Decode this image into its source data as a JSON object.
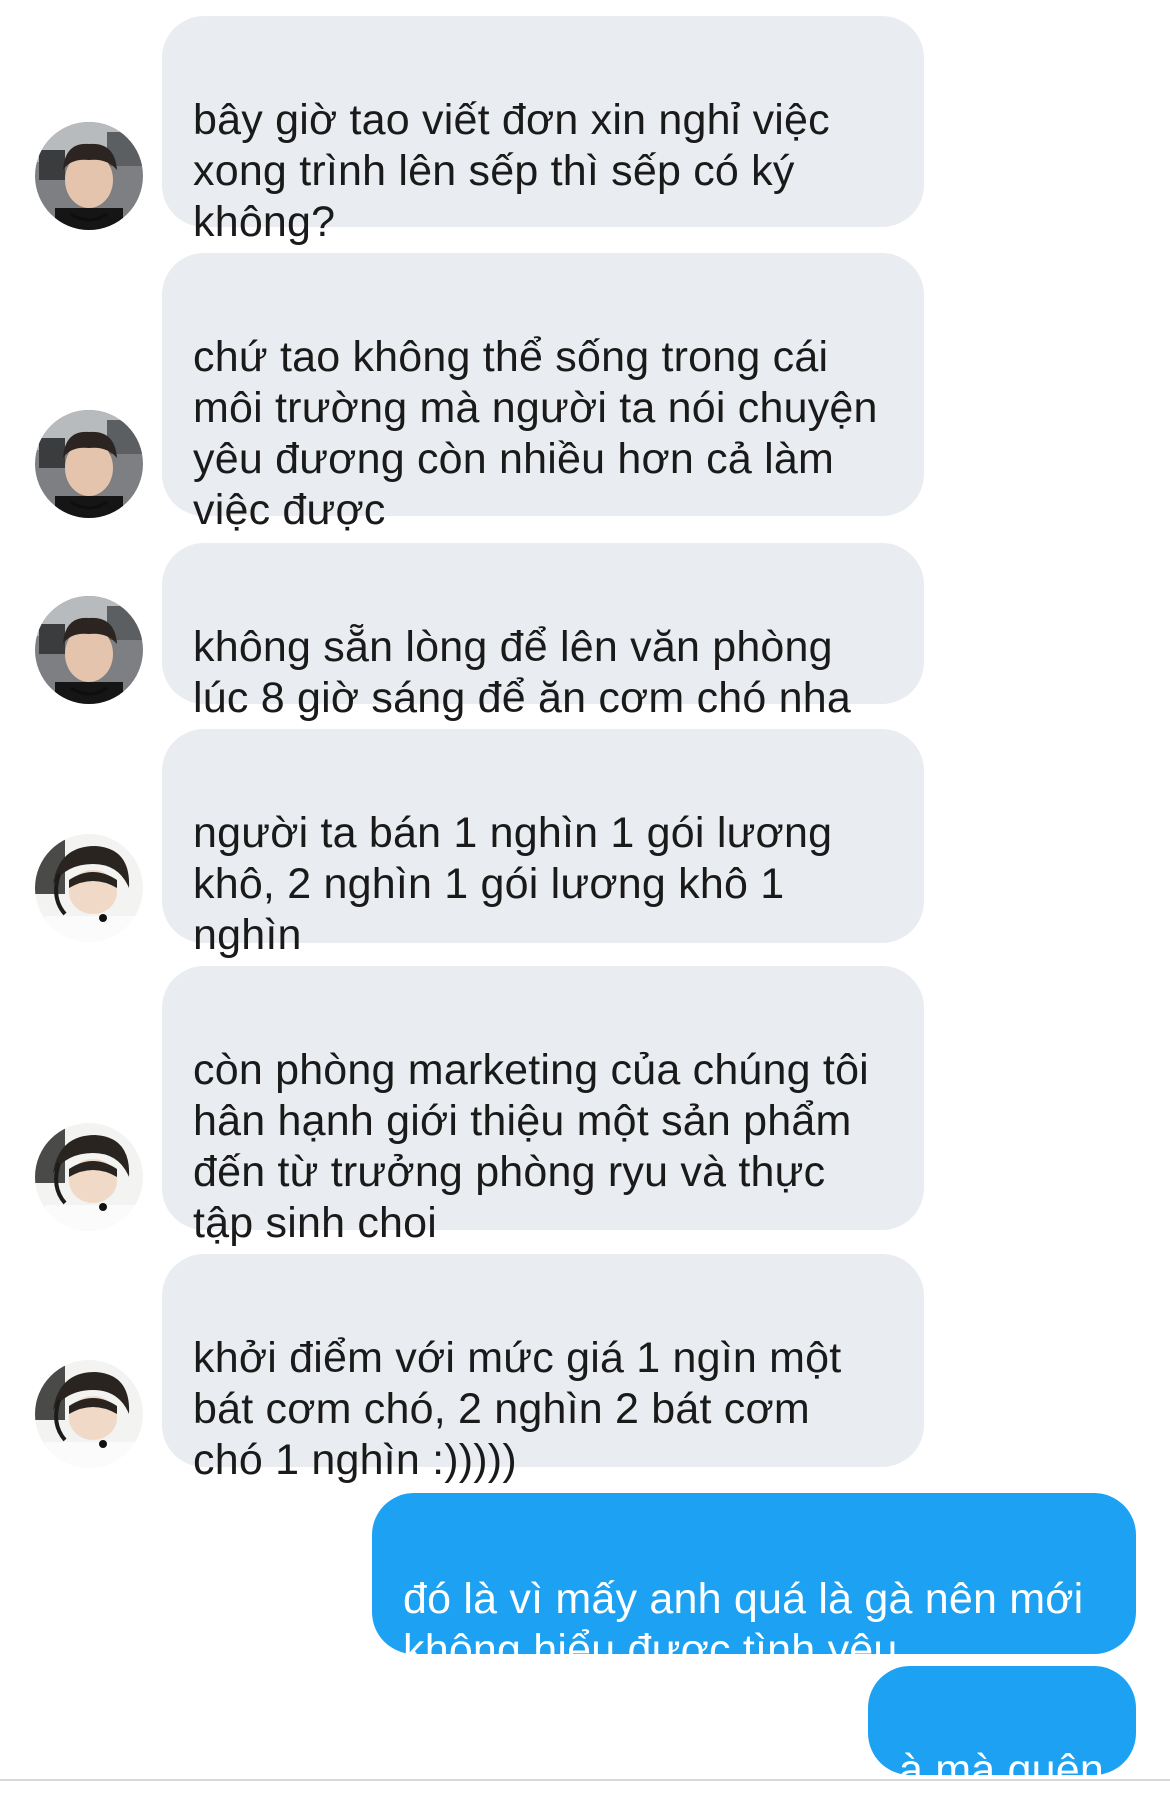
{
  "conversation": {
    "messages": [
      {
        "direction": "incoming",
        "avatar": "avatar-a",
        "text": "bây giờ tao viết đơn xin nghỉ việc\nxong trình lên sếp thì sếp có ký\nkhông?"
      },
      {
        "direction": "incoming",
        "avatar": "avatar-a",
        "text": "chứ tao không thể sống trong cái\nmôi trường mà người ta nói chuyện\nyêu đương còn nhiều hơn cả làm\nviệc được"
      },
      {
        "direction": "incoming",
        "avatar": "avatar-a",
        "text": "không sẵn lòng để lên văn phòng\nlúc 8 giờ sáng để ăn cơm chó nha"
      },
      {
        "direction": "incoming",
        "avatar": "avatar-b",
        "text": "người ta bán 1 nghìn 1 gói lương\nkhô, 2 nghìn 1 gói lương khô 1\nnghìn"
      },
      {
        "direction": "incoming",
        "avatar": "avatar-b",
        "text": "còn phòng marketing của chúng tôi\nhân hạnh giới thiệu một sản phẩm\nđến từ trưởng phòng ryu và thực\ntập sinh choi"
      },
      {
        "direction": "incoming",
        "avatar": "avatar-b",
        "text": "khởi điểm với mức giá 1 ngìn một\nbát cơm chó, 2 nghìn 2 bát cơm\nchó 1 nghìn :)))))"
      },
      {
        "direction": "outgoing",
        "text": "đó là vì mấy anh quá là gà nên mới\nkhông hiểu được tình yêu"
      },
      {
        "direction": "outgoing",
        "text": "à mà quên"
      }
    ]
  },
  "colors": {
    "incoming_bubble": "#e9ecf0",
    "outgoing_bubble": "#1da1f2",
    "incoming_text": "#1a1a1a",
    "outgoing_text": "#ffffff"
  }
}
